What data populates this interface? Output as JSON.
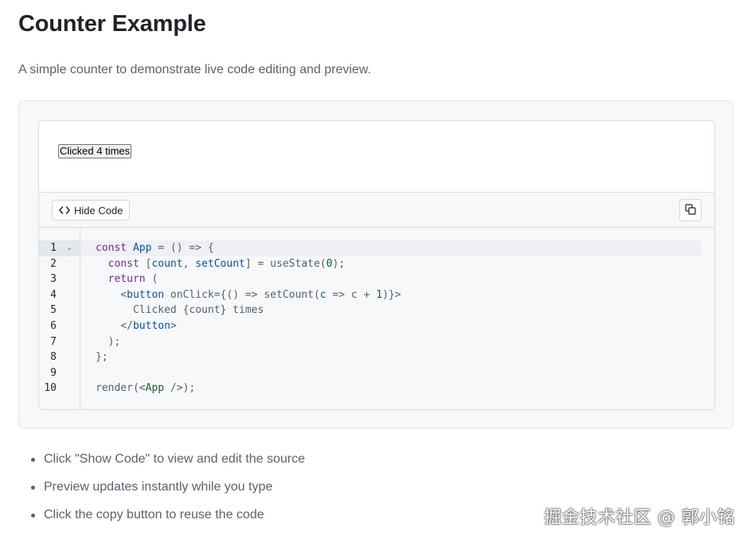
{
  "page": {
    "title": "Counter Example",
    "subtitle": "A simple counter to demonstrate live code editing and preview."
  },
  "preview": {
    "button_label": "Clicked 4 times"
  },
  "toolbar": {
    "toggle_code_label": "Hide Code",
    "toggle_code_icon": "code-brackets-icon",
    "copy_icon": "copy-icon"
  },
  "editor": {
    "line_numbers": [
      "1",
      "2",
      "3",
      "4",
      "5",
      "6",
      "7",
      "8",
      "9",
      "10"
    ],
    "fold_marker": "⌄",
    "lines": [
      [
        {
          "t": "const ",
          "c": "kw2"
        },
        {
          "t": "App",
          "c": "fn"
        },
        {
          "t": " = () => {",
          "c": "plain"
        }
      ],
      [
        {
          "t": "  const ",
          "c": "kw2"
        },
        {
          "t": "[",
          "c": "plain"
        },
        {
          "t": "count",
          "c": "fn"
        },
        {
          "t": ", ",
          "c": "plain"
        },
        {
          "t": "setCount",
          "c": "fn"
        },
        {
          "t": "] = useState(",
          "c": "plain"
        },
        {
          "t": "0",
          "c": "num"
        },
        {
          "t": ");",
          "c": "plain"
        }
      ],
      [
        {
          "t": "  return",
          "c": "kw2"
        },
        {
          "t": " (",
          "c": "plain"
        }
      ],
      [
        {
          "t": "    <",
          "c": "plain"
        },
        {
          "t": "button",
          "c": "tag"
        },
        {
          "t": " onClick={() => setCount(",
          "c": "plain"
        },
        {
          "t": "c",
          "c": "fn"
        },
        {
          "t": " => c + ",
          "c": "plain"
        },
        {
          "t": "1",
          "c": "num"
        },
        {
          "t": ")}>",
          "c": "plain"
        }
      ],
      [
        {
          "t": "      Clicked {count} times",
          "c": "plain"
        }
      ],
      [
        {
          "t": "    </",
          "c": "plain"
        },
        {
          "t": "button",
          "c": "tag"
        },
        {
          "t": ">",
          "c": "plain"
        }
      ],
      [
        {
          "t": "  );",
          "c": "plain"
        }
      ],
      [
        {
          "t": "};",
          "c": "plain"
        }
      ],
      [
        {
          "t": "",
          "c": "plain"
        }
      ],
      [
        {
          "t": "render(<",
          "c": "plain"
        },
        {
          "t": "App",
          "c": "green"
        },
        {
          "t": " />);",
          "c": "plain"
        }
      ]
    ]
  },
  "features": [
    "Click \"Show Code\" to view and edit the source",
    "Preview updates instantly while you type",
    "Click the copy button to reuse the code"
  ],
  "watermark": "掘金技术社区 @ 郭小铭"
}
